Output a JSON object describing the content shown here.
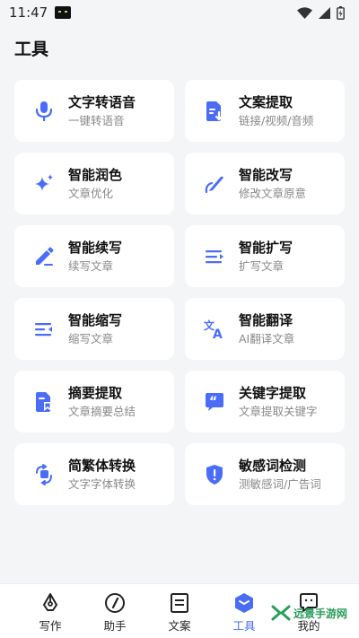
{
  "status_bar": {
    "time": "11:47"
  },
  "header": {
    "title": "工具"
  },
  "tools": [
    {
      "title": "文字转语音",
      "subtitle": "一键转语音",
      "icon": "microphone-icon"
    },
    {
      "title": "文案提取",
      "subtitle": "链接/视频/音频",
      "icon": "document-extract-icon"
    },
    {
      "title": "智能润色",
      "subtitle": "文章优化",
      "icon": "sparkle-icon"
    },
    {
      "title": "智能改写",
      "subtitle": "修改文章原意",
      "icon": "pen-curve-icon"
    },
    {
      "title": "智能续写",
      "subtitle": "续写文章",
      "icon": "edit-pen-icon"
    },
    {
      "title": "智能扩写",
      "subtitle": "扩写文章",
      "icon": "expand-lines-icon"
    },
    {
      "title": "智能缩写",
      "subtitle": "缩写文章",
      "icon": "shrink-lines-icon"
    },
    {
      "title": "智能翻译",
      "subtitle": "AI翻译文章",
      "icon": "translate-icon"
    },
    {
      "title": "摘要提取",
      "subtitle": "文章摘要总结",
      "icon": "bookmark-doc-icon"
    },
    {
      "title": "关键字提取",
      "subtitle": "文章提取关键字",
      "icon": "quote-bubble-icon"
    },
    {
      "title": "简繁体转换",
      "subtitle": "文字字体转换",
      "icon": "convert-icon"
    },
    {
      "title": "敏感词检测",
      "subtitle": "测敏感词/广告词",
      "icon": "shield-alert-icon"
    }
  ],
  "nav": {
    "write": "写作",
    "assistant": "助手",
    "copy": "文案",
    "tools": "工具",
    "mine": "我的"
  },
  "watermark": {
    "text": "远景手游网"
  },
  "colors": {
    "accent": "#4a6cf7",
    "background": "#f4f5f7",
    "card": "#ffffff"
  }
}
